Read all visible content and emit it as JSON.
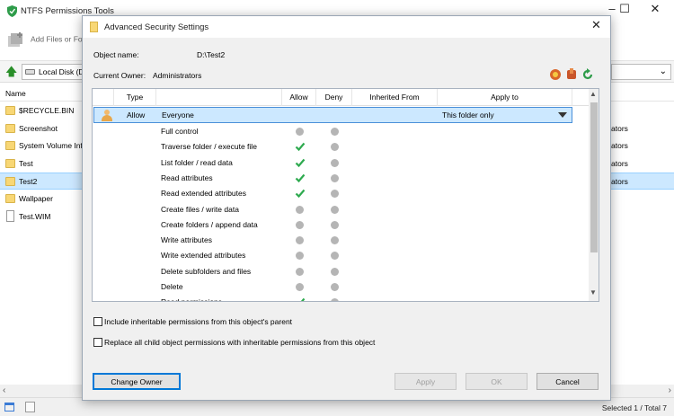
{
  "app": {
    "title": "NTFS Permissions Tools",
    "add_files_label": "Add Files or Fo",
    "drive_label": "Local Disk (D",
    "dropdown_arrow": "⌄",
    "list_header": "Name",
    "files": [
      {
        "name": "$RECYCLE.BIN",
        "type": "folder",
        "owner": "",
        "selected": false
      },
      {
        "name": "Screenshot",
        "type": "folder",
        "owner": "ators",
        "selected": false
      },
      {
        "name": "System Volume Inf",
        "type": "folder",
        "owner": "ators",
        "selected": false
      },
      {
        "name": "Test",
        "type": "folder",
        "owner": "ators",
        "selected": false
      },
      {
        "name": "Test2",
        "type": "folder",
        "owner": "ators",
        "selected": true
      },
      {
        "name": "Wallpaper",
        "type": "folder",
        "owner": "",
        "selected": false
      },
      {
        "name": "Test.WIM",
        "type": "file",
        "owner": "",
        "selected": false
      }
    ],
    "status": "Selected 1 / Total 7"
  },
  "dialog": {
    "title": "Advanced Security Settings",
    "object_name_label": "Object name:",
    "object_name_value": "D:\\Test2",
    "owner_label": "Current Owner:",
    "owner_value": "Administrators",
    "columns": [
      "Type",
      "Allow",
      "Deny",
      "Inherited From",
      "Apply to"
    ],
    "ace": {
      "type": "Allow",
      "principal": "Everyone",
      "inherited_from": "",
      "apply_to": "This folder only"
    },
    "permissions": [
      {
        "name": "Full control",
        "allow": false,
        "deny": false
      },
      {
        "name": "Traverse folder / execute file",
        "allow": true,
        "deny": false
      },
      {
        "name": "List folder / read data",
        "allow": true,
        "deny": false
      },
      {
        "name": "Read attributes",
        "allow": true,
        "deny": false
      },
      {
        "name": "Read extended attributes",
        "allow": true,
        "deny": false
      },
      {
        "name": "Create files / write data",
        "allow": false,
        "deny": false
      },
      {
        "name": "Create folders / append data",
        "allow": false,
        "deny": false
      },
      {
        "name": "Write attributes",
        "allow": false,
        "deny": false
      },
      {
        "name": "Write extended attributes",
        "allow": false,
        "deny": false
      },
      {
        "name": "Delete subfolders and files",
        "allow": false,
        "deny": false
      },
      {
        "name": "Delete",
        "allow": false,
        "deny": false
      },
      {
        "name": "Read permissions",
        "allow": true,
        "deny": false
      }
    ],
    "checkbox_inherit": "Include inheritable permissions from this object's parent",
    "checkbox_replace": "Replace all child object permissions with inheritable permissions from this object",
    "buttons": {
      "change_owner": "Change Owner",
      "apply": "Apply",
      "ok": "OK",
      "cancel": "Cancel"
    }
  },
  "colors": {
    "selection": "#cce8ff",
    "allow_check": "#2eaa4f",
    "neutral_dot": "#b5b5b5"
  }
}
